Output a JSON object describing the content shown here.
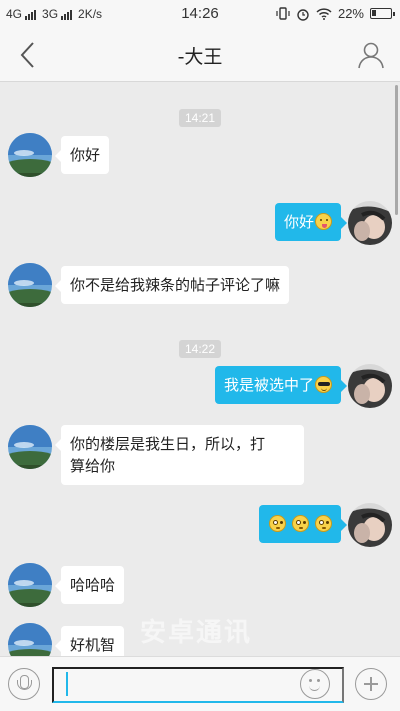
{
  "status_bar": {
    "net1": "4G",
    "net2": "3G",
    "speed": "2K/s",
    "time": "14:26",
    "battery": "22%"
  },
  "header": {
    "title": "-大王",
    "back_icon": "chevron-left-icon",
    "profile_icon": "person-icon"
  },
  "chat": {
    "timestamps": [
      "14:21",
      "14:22"
    ],
    "messages": [
      {
        "side": "in",
        "text": "你好"
      },
      {
        "side": "out",
        "text": "你好",
        "emoji": "tongue-emoji"
      },
      {
        "side": "in",
        "text": "你不是给我辣条的帖子评论了嘛"
      },
      {
        "side": "out",
        "text": "我是被选中了",
        "emoji": "sunglasses-emoji"
      },
      {
        "side": "in",
        "line1": "你的楼层是我生日，所以，打",
        "line2": "算给你"
      },
      {
        "side": "out",
        "emoji": "flushed-emoji",
        "count": 3
      },
      {
        "side": "in",
        "text": "哈哈哈"
      },
      {
        "side": "in",
        "text": "好机智"
      }
    ]
  },
  "composer": {
    "value": "",
    "mic_icon": "microphone-icon",
    "emoji_icon": "smiley-icon",
    "add_icon": "plus-icon"
  },
  "watermark": "安卓通讯",
  "colors": {
    "accent": "#21b8ea",
    "background": "#ebebeb"
  }
}
